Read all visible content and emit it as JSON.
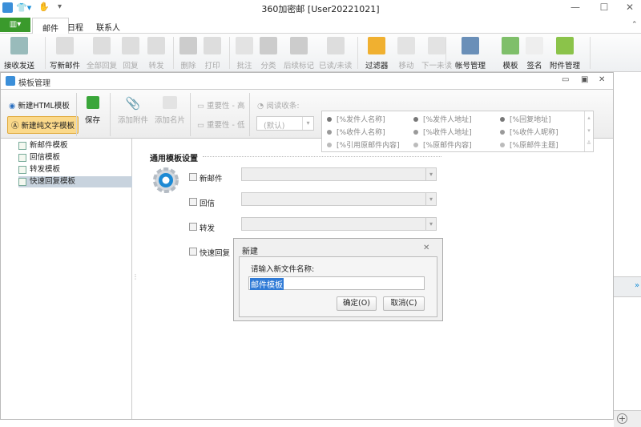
{
  "app": {
    "title": "360加密邮 [User20221021]",
    "file_button": "▥▾"
  },
  "tabs": [
    "邮件",
    "日程",
    "联系人"
  ],
  "ribbon": [
    {
      "label": "接收发送",
      "disabled": false
    },
    {
      "label": "写新邮件",
      "disabled": false
    },
    {
      "label": "全部回复",
      "disabled": true
    },
    {
      "label": "回复",
      "disabled": true
    },
    {
      "label": "转发",
      "disabled": true
    },
    {
      "label": "删除",
      "disabled": true
    },
    {
      "label": "打印",
      "disabled": true
    },
    {
      "label": "批注",
      "disabled": true
    },
    {
      "label": "分类",
      "disabled": true
    },
    {
      "label": "后续标记",
      "disabled": true
    },
    {
      "label": "已读/未读",
      "disabled": true
    },
    {
      "label": "过滤器",
      "disabled": false
    },
    {
      "label": "移动",
      "disabled": true
    },
    {
      "label": "下一未读",
      "disabled": true
    },
    {
      "label": "帐号管理",
      "disabled": false
    },
    {
      "label": "模板",
      "disabled": false
    },
    {
      "label": "签名",
      "disabled": false
    },
    {
      "label": "附件管理",
      "disabled": false
    }
  ],
  "window": {
    "title": "模板管理"
  },
  "toolbar": {
    "new_html": "新建HTML模板",
    "new_text": "新建纯文字模板",
    "save": "保存",
    "add_attachment": "添加附件",
    "add_card": "添加名片",
    "importance_high": "重要性 - 高",
    "importance_low": "重要性 - 低",
    "read_receipt": "阅读收条:",
    "read_receipt_value": "(默认)"
  },
  "variables": [
    "[%发件人名称]",
    "[%发件人地址]",
    "[%回复地址]",
    "[%收件人名称]",
    "[%收件人地址]",
    "[%收件人昵称]",
    "[%引用原邮件内容]",
    "[%原邮件内容]",
    "[%原邮件主题]"
  ],
  "tree": [
    "新邮件模板",
    "回信模板",
    "转发模板",
    "快速回复模板"
  ],
  "settings": {
    "title": "通用模板设置",
    "rows": [
      "新邮件",
      "回信",
      "转发",
      "快速回复"
    ]
  },
  "dialog": {
    "title": "新建",
    "prompt": "请输入新文件名称:",
    "value": "邮件模板",
    "ok": "确定(O)",
    "cancel": "取消(C)"
  }
}
